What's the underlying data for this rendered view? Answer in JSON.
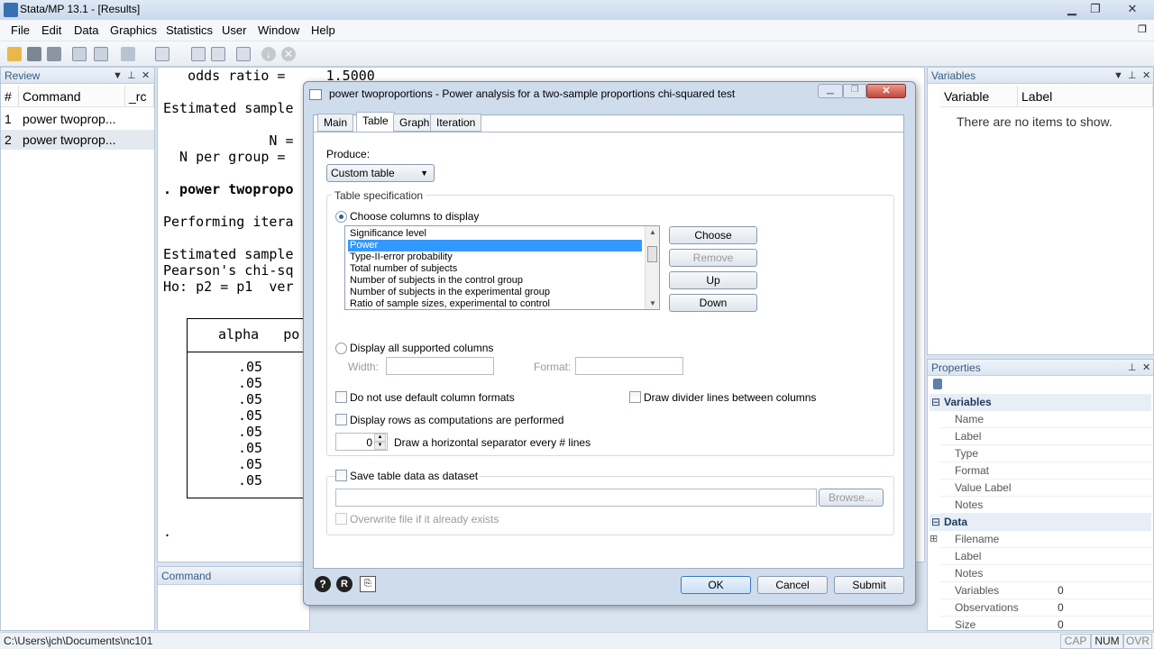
{
  "window": {
    "title": "Stata/MP 13.1 - [Results]",
    "min": "▁",
    "max": "❐",
    "close": "✕"
  },
  "menu": [
    "File",
    "Edit",
    "Data",
    "Graphics",
    "Statistics",
    "User",
    "Window",
    "Help"
  ],
  "review": {
    "title": "Review",
    "cols": [
      "#",
      "Command",
      "_rc"
    ],
    "rows": [
      {
        "n": "1",
        "cmd": "power twoprop..."
      },
      {
        "n": "2",
        "cmd": "power twoprop..."
      }
    ]
  },
  "results": {
    "lines": [
      "   odds ratio =     1.5000",
      "Estimated sample",
      "             N =",
      "  N per group =",
      ". power twopropo",
      "Performing itera",
      "Estimated sample",
      "Pearson's chi-sq",
      "Ho: p2 = p1  ver"
    ],
    "table_header": "alpha   po",
    "alpha_values": [
      ".05",
      ".05",
      ".05",
      ".05",
      ".05",
      ".05",
      ".05",
      ".05"
    ],
    "prompt": "."
  },
  "command_panel": {
    "title": "Command"
  },
  "variables": {
    "title": "Variables",
    "cols": [
      "Variable",
      "Label"
    ],
    "empty": "There are no items to show."
  },
  "properties": {
    "title": "Properties",
    "sections": [
      {
        "name": "Variables",
        "rows": [
          {
            "k": "Name",
            "v": ""
          },
          {
            "k": "Label",
            "v": ""
          },
          {
            "k": "Type",
            "v": ""
          },
          {
            "k": "Format",
            "v": ""
          },
          {
            "k": "Value Label",
            "v": ""
          },
          {
            "k": "Notes",
            "v": ""
          }
        ]
      },
      {
        "name": "Data",
        "rows": [
          {
            "k": "Filename",
            "v": ""
          },
          {
            "k": "Label",
            "v": ""
          },
          {
            "k": "Notes",
            "v": ""
          },
          {
            "k": "Variables",
            "v": "0"
          },
          {
            "k": "Observations",
            "v": "0"
          },
          {
            "k": "Size",
            "v": "0"
          }
        ]
      }
    ]
  },
  "status": {
    "path": "C:\\Users\\jch\\Documents\\nc101",
    "cap": "CAP",
    "num": "NUM",
    "ovr": "OVR"
  },
  "dialog": {
    "title": "power twoproportions - Power analysis for a two-sample proportions chi-squared test",
    "tabs": [
      "Main",
      "Table",
      "Graph",
      "Iteration"
    ],
    "produce_label": "Produce:",
    "produce_value": "Custom table",
    "table_spec": "Table specification",
    "choose_columns": "Choose columns to display",
    "columns": [
      "Significance level",
      "Power",
      "Type-II-error probability",
      "Total number of subjects",
      "Number of subjects in the control group",
      "Number of subjects in the experimental group",
      "Ratio of sample sizes, experimental to control"
    ],
    "selected_column": "Power",
    "buttons": {
      "choose": "Choose",
      "remove": "Remove",
      "up": "Up",
      "down": "Down"
    },
    "display_all": "Display all supported columns",
    "width_label": "Width:",
    "format_label": "Format:",
    "no_default_formats": "Do not use default column formats",
    "divider_lines": "Draw divider lines between columns",
    "display_rows": "Display rows as computations are performed",
    "separator_value": "0",
    "separator_label": "Draw a horizontal separator every # lines",
    "save_table": "Save table data as dataset",
    "browse": "Browse...",
    "overwrite": "Overwrite file if it already exists",
    "ok": "OK",
    "cancel": "Cancel",
    "submit": "Submit"
  }
}
